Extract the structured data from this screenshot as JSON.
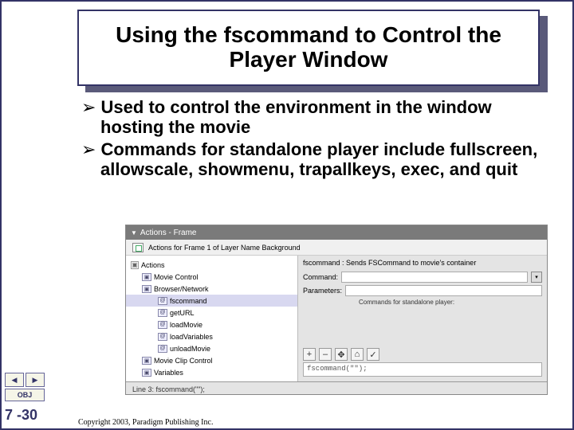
{
  "title": "Using the fscommand to Control the Player Window",
  "bullets": [
    "Used to control the environment in the window hosting the movie",
    "Commands for standalone player include fullscreen, allowscale, showmenu, trapallkeys, exec, and quit"
  ],
  "panel": {
    "header": "Actions - Frame",
    "subheader": "Actions for Frame 1 of Layer Name Background",
    "tree": [
      {
        "lvl": 1,
        "icon": "sq",
        "label": "Actions"
      },
      {
        "lvl": 2,
        "icon": "fi",
        "label": "Movie Control"
      },
      {
        "lvl": 2,
        "icon": "fi",
        "label": "Browser/Network"
      },
      {
        "lvl": 3,
        "icon": "fi",
        "label": "fscommand",
        "sel": true
      },
      {
        "lvl": 3,
        "icon": "fi",
        "label": "getURL"
      },
      {
        "lvl": 3,
        "icon": "fi",
        "label": "loadMovie"
      },
      {
        "lvl": 3,
        "icon": "fi",
        "label": "loadVariables"
      },
      {
        "lvl": 3,
        "icon": "fi",
        "label": "unloadMovie"
      },
      {
        "lvl": 2,
        "icon": "fi",
        "label": "Movie Clip Control"
      },
      {
        "lvl": 2,
        "icon": "fi",
        "label": "Variables"
      }
    ],
    "desc": "fscommand : Sends FSCommand to movie's container",
    "fields": {
      "command_label": "Command:",
      "params_label": "Parameters:",
      "hint": "Commands for standalone player:"
    },
    "toolbar": [
      "+",
      "–",
      "✥",
      "⌂",
      "✓"
    ],
    "codebox": "fscommand(\"\");",
    "statusbar": "Line 3: fscommand(\"\");"
  },
  "nav": {
    "prev": "◀",
    "next": "▶",
    "obj": "OBJ"
  },
  "pageNumber": "7 -30",
  "copyright": "Copyright 2003, Paradigm Publishing Inc."
}
